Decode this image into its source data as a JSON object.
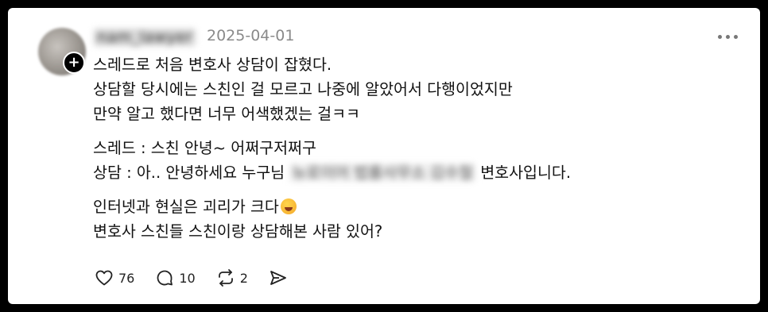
{
  "post": {
    "username": "nam_lawyer",
    "date": "2025-04-01",
    "avatar_icon": "user-avatar",
    "more_icon": "more-horizontal-icon",
    "lines": [
      "스레드로 처음 변호사 상담이 잡혔다.",
      "상담할 당시에는 스친인 걸 모르고 나중에 알았어서 다행이었지만",
      "만약 알고 했다면 너무 어색했겠는 걸ㅋㅋ"
    ],
    "dialogue_line1": "스레드 : 스친 안녕~ 어쩌구저쩌구",
    "dialogue_line2_prefix": "상담 : 아.. 안녕하세요 누구님",
    "dialogue_line2_blurred": "뉴로이어 법률사무소 김수철",
    "dialogue_line2_suffix": "변호사입니다.",
    "closing_line1": "인터넷과 현실은 괴리가 크다",
    "closing_emoji": "grinning-sweat-emoji",
    "closing_line2": "변호사 스친들 스친이랑 상담해본 사람 있어?"
  },
  "actions": {
    "like_count": "76",
    "comment_count": "10",
    "repost_count": "2",
    "icons": [
      "heart-icon",
      "comment-icon",
      "repost-icon",
      "share-icon"
    ]
  },
  "colors": {
    "background": "#000000",
    "card": "#ffffff",
    "date": "#8a8a8a"
  }
}
